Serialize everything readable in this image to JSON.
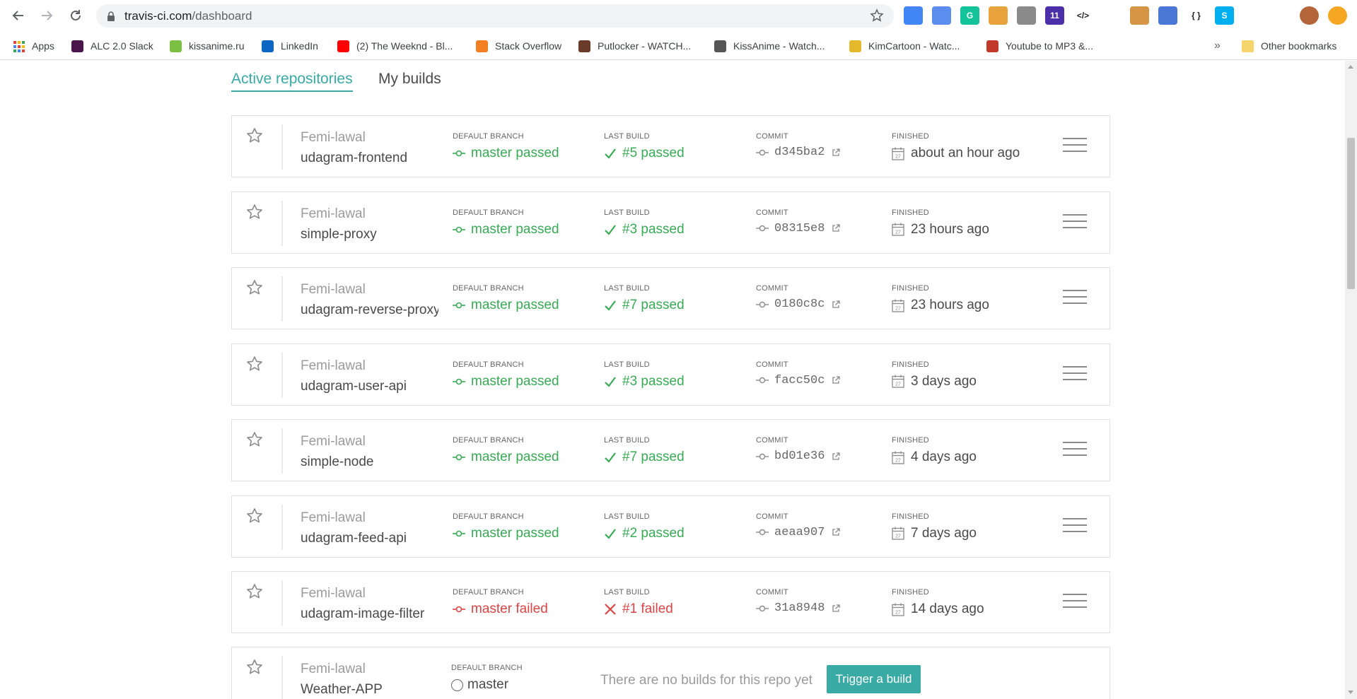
{
  "browser": {
    "url_host": "travis-ci.com",
    "url_path": "/dashboard",
    "extensions": [
      {
        "name": "ext-google",
        "color": "#4285f4",
        "text": ""
      },
      {
        "name": "ext-blue-circle",
        "color": "#5b8def",
        "text": ""
      },
      {
        "name": "ext-grammarly",
        "color": "#15c39a",
        "text": "G"
      },
      {
        "name": "ext-bowl",
        "color": "#e8a33d",
        "text": ""
      },
      {
        "name": "ext-gear",
        "color": "#8a8a8a",
        "text": ""
      },
      {
        "name": "ext-graduate",
        "color": "#4b2fa8",
        "text": "11"
      },
      {
        "name": "ext-code",
        "color": "#ffffff",
        "text": "</>"
      },
      {
        "name": "ext-note",
        "color": "#ffffff",
        "text": ""
      },
      {
        "name": "ext-cookie",
        "color": "#d59545",
        "text": ""
      },
      {
        "name": "ext-globe-search",
        "color": "#4a76d6",
        "text": ""
      },
      {
        "name": "ext-braces",
        "color": "#ffffff",
        "text": "{ }"
      },
      {
        "name": "ext-skype",
        "color": "#00aff0",
        "text": "S"
      },
      {
        "name": "ext-puzzle",
        "color": "#ffffff",
        "text": ""
      },
      {
        "name": "ext-media",
        "color": "#ffffff",
        "text": ""
      },
      {
        "name": "profile-avatar",
        "color": "#b5653a",
        "text": ""
      },
      {
        "name": "ext-orange",
        "color": "#f5a623",
        "text": ""
      }
    ],
    "bookmarks": [
      {
        "label": "Apps",
        "color": "#e94235"
      },
      {
        "label": "ALC 2.0 Slack",
        "color": "#4a154b"
      },
      {
        "label": "kissanime.ru",
        "color": "#7cc043"
      },
      {
        "label": "LinkedIn",
        "color": "#0a66c2"
      },
      {
        "label": "(2) The Weeknd - Bl...",
        "color": "#ff0000"
      },
      {
        "label": "Stack Overflow",
        "color": "#f48024"
      },
      {
        "label": "Putlocker - WATCH...",
        "color": "#6b3b2a"
      },
      {
        "label": "KissAnime - Watch...",
        "color": "#555555"
      },
      {
        "label": "KimCartoon - Watc...",
        "color": "#e5b92c"
      },
      {
        "label": "Youtube to MP3 &...",
        "color": "#c0392b"
      }
    ],
    "overflow_label": "»",
    "other_bookmarks_label": "Other bookmarks"
  },
  "tabs": {
    "active": "Active repositories",
    "inactive": "My builds"
  },
  "labels": {
    "default_branch": "DEFAULT BRANCH",
    "last_build": "LAST BUILD",
    "commit": "COMMIT",
    "finished": "FINISHED"
  },
  "repos": [
    {
      "owner": "Femi-lawal",
      "name": "udagram-frontend",
      "branch": "master passed",
      "build": "#5 passed",
      "commit": "d345ba2",
      "finished": "about an hour ago",
      "status": "passed"
    },
    {
      "owner": "Femi-lawal",
      "name": "simple-proxy",
      "branch": "master passed",
      "build": "#3 passed",
      "commit": "08315e8",
      "finished": "23 hours ago",
      "status": "passed"
    },
    {
      "owner": "Femi-lawal",
      "name": "udagram-reverse-proxy",
      "branch": "master passed",
      "build": "#7 passed",
      "commit": "0180c8c",
      "finished": "23 hours ago",
      "status": "passed"
    },
    {
      "owner": "Femi-lawal",
      "name": "udagram-user-api",
      "branch": "master passed",
      "build": "#3 passed",
      "commit": "facc50c",
      "finished": "3 days ago",
      "status": "passed"
    },
    {
      "owner": "Femi-lawal",
      "name": "simple-node",
      "branch": "master passed",
      "build": "#7 passed",
      "commit": "bd01e36",
      "finished": "4 days ago",
      "status": "passed"
    },
    {
      "owner": "Femi-lawal",
      "name": "udagram-feed-api",
      "branch": "master passed",
      "build": "#2 passed",
      "commit": "aeaa907",
      "finished": "7 days ago",
      "status": "passed"
    },
    {
      "owner": "Femi-lawal",
      "name": "udagram-image-filter",
      "branch": "master failed",
      "build": "#1 failed",
      "commit": "31a8948",
      "finished": "14 days ago",
      "status": "failed"
    }
  ],
  "last_repo": {
    "owner": "Femi-lawal",
    "name": "Weather-APP",
    "branch": "master",
    "no_builds_text": "There are no builds for this repo yet",
    "trigger_label": "Trigger a build"
  },
  "calendar_day": "27",
  "colors": {
    "accent": "#39aaa4",
    "passed": "#39aa56",
    "failed": "#db4545"
  }
}
